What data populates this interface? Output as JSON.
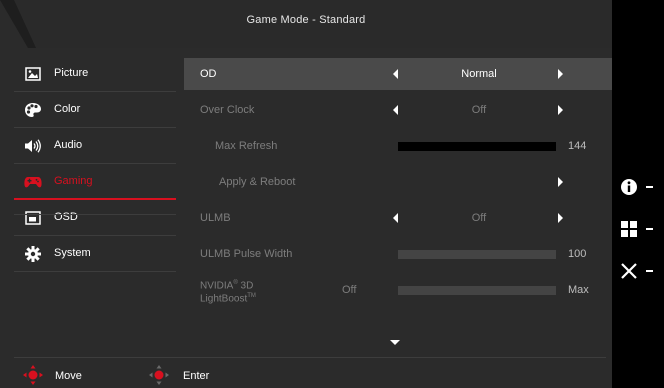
{
  "header": {
    "title": "Game Mode - Standard"
  },
  "sidebar": {
    "items": [
      {
        "label": "Picture",
        "icon": "picture-icon"
      },
      {
        "label": "Color",
        "icon": "palette-icon"
      },
      {
        "label": "Audio",
        "icon": "speaker-icon"
      },
      {
        "label": "Gaming",
        "icon": "gamepad-icon",
        "active": true
      },
      {
        "label": "OSD",
        "icon": "osd-window-icon"
      },
      {
        "label": "System",
        "icon": "gear-icon"
      }
    ]
  },
  "settings": {
    "od": {
      "label": "OD",
      "value": "Normal"
    },
    "overclock": {
      "label": "Over Clock",
      "value": "Off"
    },
    "max_refresh": {
      "label": "Max Refresh",
      "value": "144",
      "fill": 1.0
    },
    "apply_reboot": {
      "label": "Apply & Reboot"
    },
    "ulmb": {
      "label": "ULMB",
      "value": "Off"
    },
    "ulmb_pulse": {
      "label": "ULMB Pulse Width",
      "value": "100",
      "fill": 0.0
    },
    "lightboost": {
      "label_line1": "NVIDIA",
      "reg": "®",
      "label_3d": " 3D",
      "label_line2": "LightBoost",
      "tm": "TM",
      "state": "Off",
      "value": "Max",
      "fill": 0.0
    }
  },
  "footer": {
    "move_label": "Move",
    "enter_label": "Enter"
  },
  "right_panel": {
    "buttons": [
      "info-icon",
      "grid-icon",
      "close-icon"
    ]
  },
  "colors": {
    "accent": "#d8101f",
    "highlight_row": "#4a4a4a",
    "background": "#2b2b2b"
  }
}
